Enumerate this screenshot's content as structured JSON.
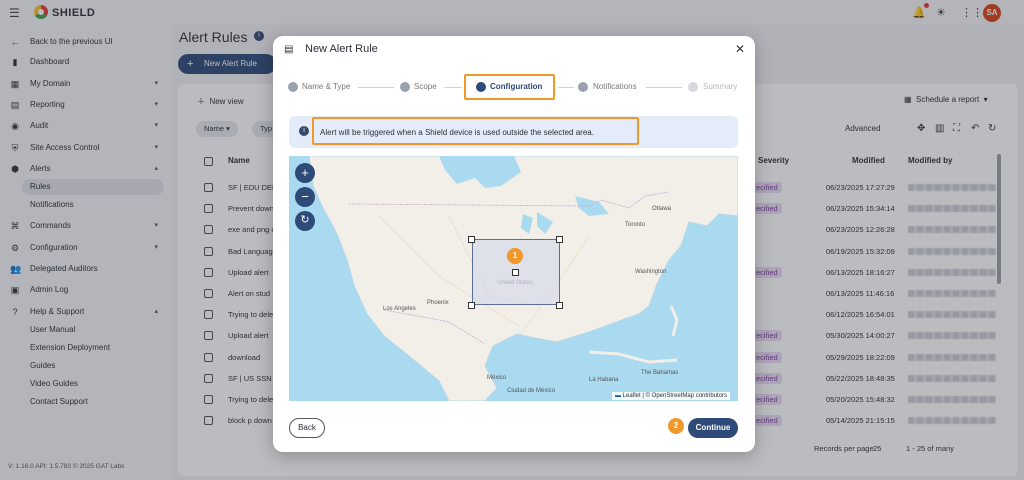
{
  "app": {
    "brand": "SHIELD",
    "avatar_initials": "SA"
  },
  "sidebar": {
    "items": [
      {
        "label": "Back to the previous UI",
        "icon": "arrow-left-icon"
      },
      {
        "label": "Dashboard",
        "icon": "bar-chart-icon"
      },
      {
        "label": "My Domain",
        "icon": "building-icon"
      },
      {
        "label": "Reporting",
        "icon": "report-icon"
      },
      {
        "label": "Audit",
        "icon": "audit-icon"
      },
      {
        "label": "Site Access Control",
        "icon": "shield-icon"
      },
      {
        "label": "Alerts",
        "icon": "alert-icon"
      },
      {
        "label": "Commands",
        "icon": "commands-icon"
      },
      {
        "label": "Configuration",
        "icon": "gear-icon"
      },
      {
        "label": "Delegated Auditors",
        "icon": "people-icon"
      },
      {
        "label": "Admin Log",
        "icon": "log-icon"
      },
      {
        "label": "Help & Support",
        "icon": "help-icon"
      }
    ],
    "alerts_sub": [
      "Rules",
      "Notifications"
    ],
    "help_sub": [
      "User Manual",
      "Extension Deployment",
      "Guides",
      "Video Guides",
      "Contact Support"
    ],
    "version": "V: 1.16.0   API: 1.5.783  © 2025 GAT Labs"
  },
  "page": {
    "title": "Alert Rules",
    "new_button": "New Alert Rule",
    "new_view": "New view",
    "filter_name": "Name",
    "filter_type": "Typ",
    "schedule": "Schedule a report",
    "advanced": "Advanced",
    "columns": {
      "name": "Name",
      "severity": "Severity",
      "modified": "Modified",
      "modified_by": "Modified by"
    },
    "rows": [
      {
        "name": "SF | EDU DEM",
        "sev": "ecified",
        "mod": "06/23/2025 17:27:29"
      },
      {
        "name": "Prevent down",
        "sev": "ecified",
        "mod": "06/23/2025 15:34:14"
      },
      {
        "name": "exe and png c",
        "sev": "",
        "mod": "06/23/2025 12:26:28"
      },
      {
        "name": "Bad Language",
        "sev": "",
        "mod": "06/19/2025 15:32:09"
      },
      {
        "name": "Upload alert",
        "sev": "ecified",
        "mod": "06/13/2025 18:16:27"
      },
      {
        "name": "Alert on stud",
        "sev": "",
        "mod": "06/13/2025 11:46:16"
      },
      {
        "name": "Trying to dele",
        "sev": "",
        "mod": "06/12/2025 16:54:01"
      },
      {
        "name": "Upload alert",
        "sev": "ecified",
        "mod": "05/30/2025 14:00:27"
      },
      {
        "name": "download",
        "sev": "ecified",
        "mod": "05/29/2025 18:22:09"
      },
      {
        "name": "SF | US SSN I",
        "sev": "ecified",
        "mod": "05/22/2025 18:48:35"
      },
      {
        "name": "Trying to dele",
        "sev": "ecified",
        "mod": "05/20/2025 15:48:32"
      },
      {
        "name": "block p down",
        "sev": "ecified",
        "mod": "05/14/2025 21:15:15"
      }
    ],
    "pager": {
      "label": "Records per page",
      "per_page": "25",
      "range": "1 - 25 of many"
    }
  },
  "modal": {
    "title": "New Alert Rule",
    "steps": [
      "Name & Type",
      "Scope",
      "Configuration",
      "Notifications",
      "Summary"
    ],
    "banner": "Alert will be triggered when a Shield device is used outside the selected area.",
    "map_labels": {
      "ottawa": "Ottawa",
      "toronto": "Toronto",
      "washington": "Washington",
      "los_angeles": "Los Angeles",
      "phoenix": "Phoenix",
      "united_states": "United States",
      "mexico": "México",
      "ciudad": "Ciudad de México",
      "habana": "La Habana",
      "bahamas": "The Bahamas"
    },
    "attribution": "Leaflet | © OpenStreetMap contributors",
    "badge1": "1",
    "badge2": "2",
    "back": "Back",
    "continue": "Continue"
  }
}
